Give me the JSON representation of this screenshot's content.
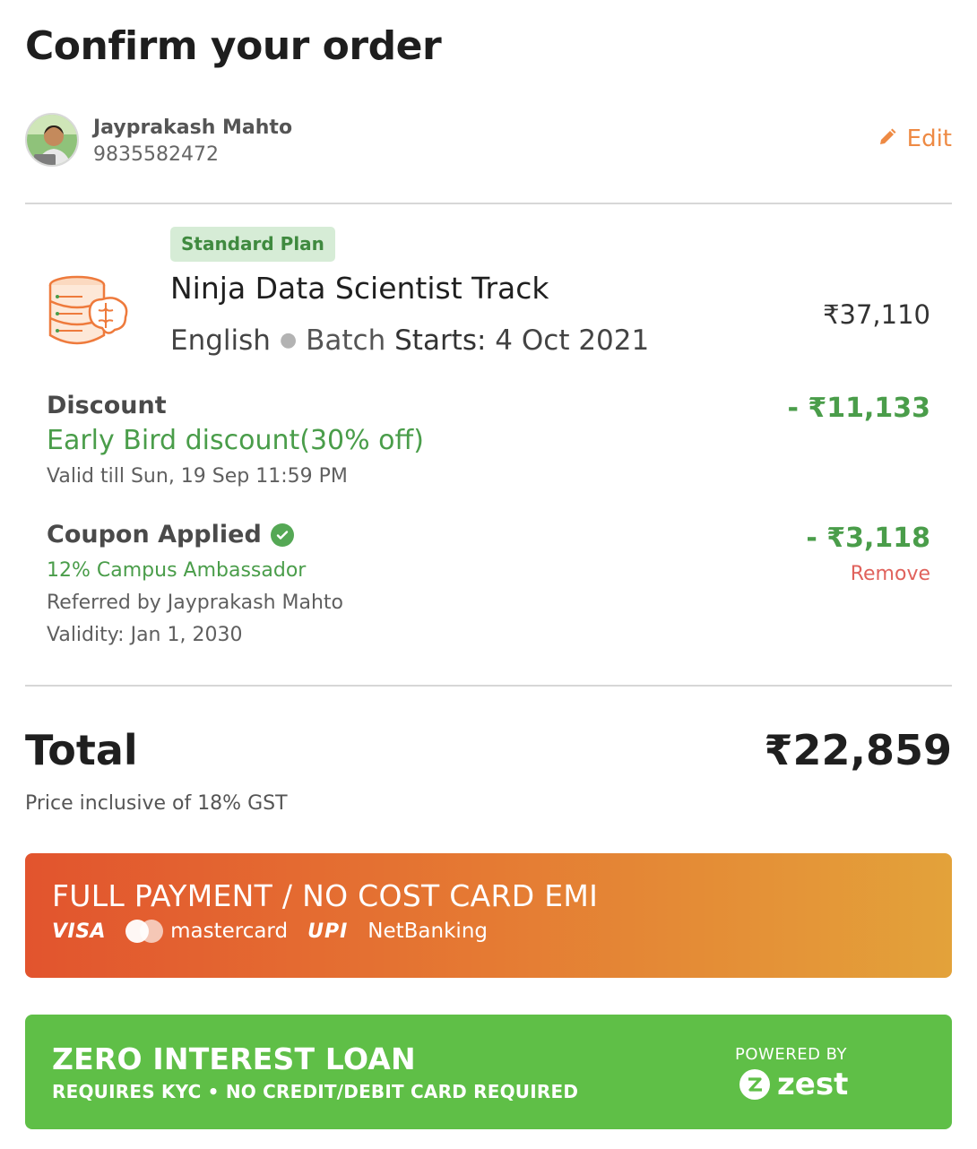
{
  "page": {
    "title": "Confirm your order"
  },
  "user": {
    "name": "Jayprakash Mahto",
    "phone": "9835582472",
    "edit_label": "Edit"
  },
  "course": {
    "plan_badge": "Standard Plan",
    "title": "Ninja Data Scientist Track",
    "language": "English",
    "batch_prefix": "Batch ",
    "batch_label": "Starts:",
    "batch_date": " 4 Oct 2021",
    "price": "₹37,110"
  },
  "discount": {
    "label": "Discount",
    "name": "Early Bird discount(30% off)",
    "valid": "Valid till Sun, 19 Sep 11:59 PM",
    "amount": "- ₹11,133"
  },
  "coupon": {
    "label": "Coupon Applied",
    "name": "12% Campus Ambassador",
    "referred": "Referred by Jayprakash Mahto",
    "validity": "Validity: Jan 1, 2030",
    "amount": "- ₹3,118",
    "remove_label": "Remove"
  },
  "total": {
    "label": "Total",
    "amount": "₹22,859",
    "gst_note": "Price inclusive of 18% GST"
  },
  "payment": {
    "title": "FULL PAYMENT / NO COST CARD EMI",
    "methods": {
      "visa": "VISA",
      "mastercard": "mastercard",
      "upi": "UPI",
      "netbanking": "NetBanking"
    }
  },
  "loan": {
    "title": "ZERO INTEREST LOAN",
    "subtitle": "REQUIRES KYC • NO CREDIT/DEBIT CARD REQUIRED",
    "powered_by": "POWERED BY",
    "brand": "zest"
  },
  "colors": {
    "accent_orange": "#ee8a44",
    "discount_green": "#4a9d4a",
    "remove_red": "#e0625c",
    "loan_green": "#5fbf47"
  },
  "icons": {
    "edit": "pencil-icon",
    "coupon_ok": "check-circle-icon",
    "course": "database-brain-icon"
  }
}
